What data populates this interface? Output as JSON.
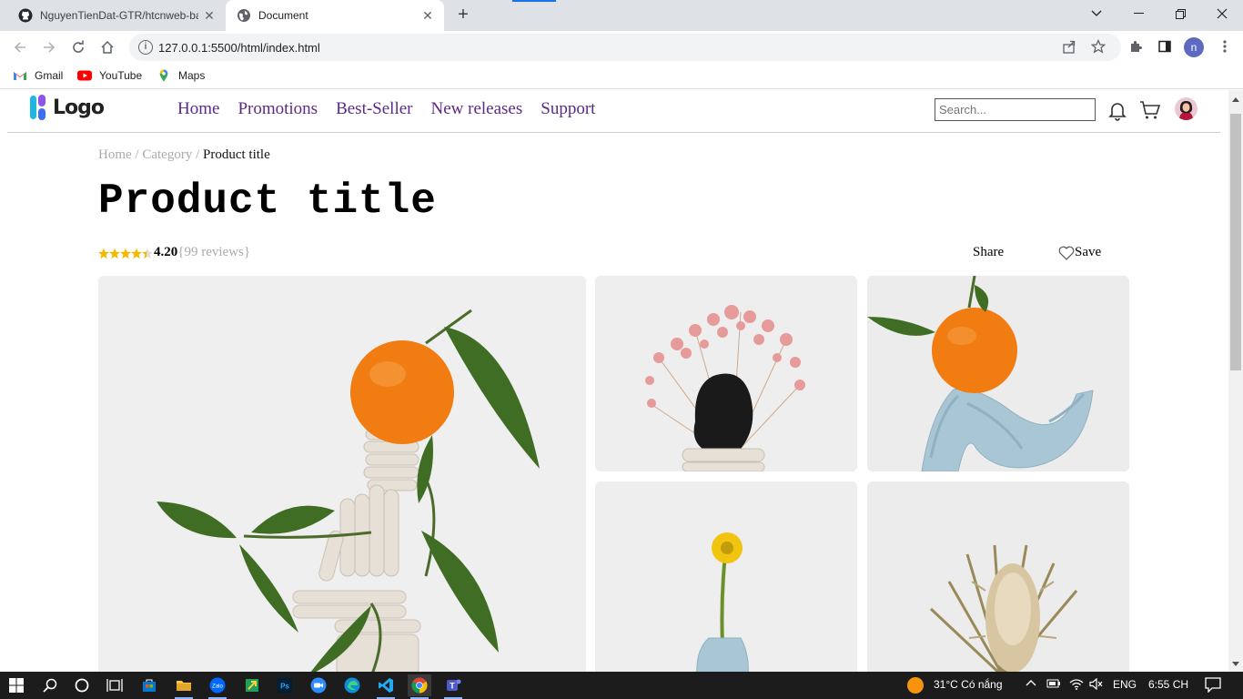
{
  "browser": {
    "tabs": [
      {
        "title": "NguyenTienDat-GTR/htcnweb-ba",
        "icon": "github-icon",
        "active": false
      },
      {
        "title": "Document",
        "icon": "globe-icon",
        "active": true
      }
    ],
    "url": "127.0.0.1:5500/html/index.html",
    "bookmarks": [
      {
        "label": "Gmail",
        "icon": "gmail-icon"
      },
      {
        "label": "YouTube",
        "icon": "youtube-icon"
      },
      {
        "label": "Maps",
        "icon": "maps-icon"
      }
    ],
    "profile_initial": "n"
  },
  "site": {
    "logo_text": "Logo",
    "nav": [
      "Home",
      "Promotions",
      "Best-Seller",
      "New releases",
      "Support"
    ],
    "search_placeholder": "Search..."
  },
  "breadcrumb": {
    "items": [
      "Home",
      "Category"
    ],
    "separator": "/",
    "current": "Product title"
  },
  "product": {
    "title": "Product title",
    "rating": 4.2,
    "rating_label": "4.20",
    "reviews_label": "{99 reviews}",
    "share_label": "Share",
    "save_label": "Save"
  },
  "gallery": [
    {
      "name": "main-image",
      "subject": "tangerine on ceramic stack with leaves"
    },
    {
      "name": "thumb-1",
      "subject": "pink gypsophila with black rock"
    },
    {
      "name": "thumb-2",
      "subject": "tangerine on blue ceramic"
    },
    {
      "name": "thumb-3",
      "subject": "yellow flower in blue vase"
    },
    {
      "name": "thumb-4",
      "subject": "dried banksia flower"
    }
  ],
  "taskbar": {
    "weather": "31°C  Có nắng",
    "language": "ENG",
    "time": "6:55 CH"
  },
  "colors": {
    "nav_link": "#5b2a86",
    "star": "#f5b800",
    "chrome_bg": "#dee1e6"
  }
}
